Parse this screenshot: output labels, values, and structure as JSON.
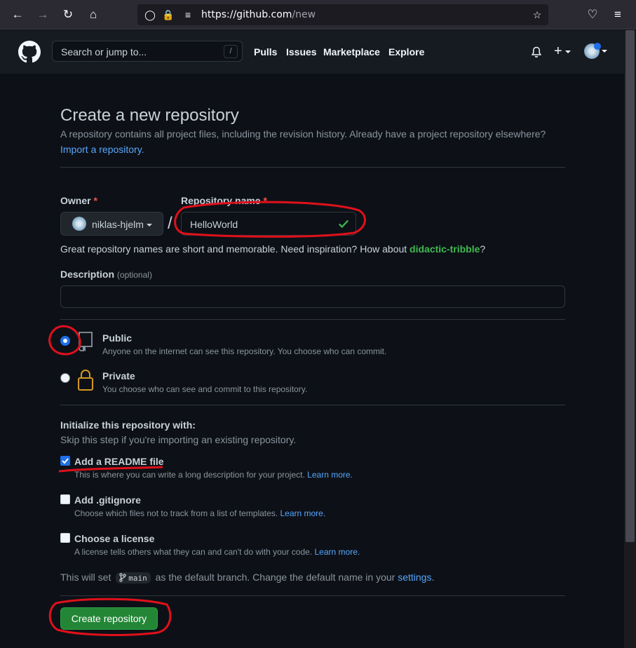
{
  "browser": {
    "url_host": "https://github.com",
    "url_path": "/new"
  },
  "header": {
    "search_placeholder": "Search or jump to...",
    "search_shortcut": "/",
    "nav": [
      "Pulls",
      "Issues",
      "Marketplace",
      "Explore"
    ]
  },
  "page": {
    "title": "Create a new repository",
    "subtitle": "A repository contains all project files, including the revision history. Already have a project repository elsewhere?",
    "import_link": "Import a repository.",
    "owner_label": "Owner",
    "required_mark": "*",
    "owner_value": "niklas-hjelm",
    "separator": "/",
    "repo_label": "Repository name",
    "repo_value": "HelloWorld",
    "hint_prefix": "Great repository names are short and memorable. Need inspiration? How about ",
    "hint_suggestion": "didactic-tribble",
    "hint_suffix": "?",
    "description_label": "Description",
    "description_optional": "(optional)",
    "description_value": ""
  },
  "visibility": {
    "public_title": "Public",
    "public_desc": "Anyone on the internet can see this repository. You choose who can commit.",
    "private_title": "Private",
    "private_desc": "You choose who can see and commit to this repository.",
    "selected": "public"
  },
  "init": {
    "heading": "Initialize this repository with:",
    "sub": "Skip this step if you're importing an existing repository.",
    "learn_more": "Learn more.",
    "readme_title": "Add a README file",
    "readme_desc": "This is where you can write a long description for your project.",
    "readme_checked": true,
    "gitignore_title": "Add .gitignore",
    "gitignore_desc": "Choose which files not to track from a list of templates.",
    "gitignore_checked": false,
    "license_title": "Choose a license",
    "license_desc": "A license tells others what they can and can't do with your code.",
    "license_checked": false
  },
  "branch": {
    "prefix": "This will set",
    "name": "main",
    "middle": "as the default branch. Change the default name in your",
    "settings_link": "settings",
    "suffix": "."
  },
  "submit": {
    "label": "Create repository"
  },
  "colors": {
    "annotation": "#e0101b",
    "primary_button": "#238636",
    "link": "#58a6ff",
    "suggestion": "#3fb950"
  }
}
